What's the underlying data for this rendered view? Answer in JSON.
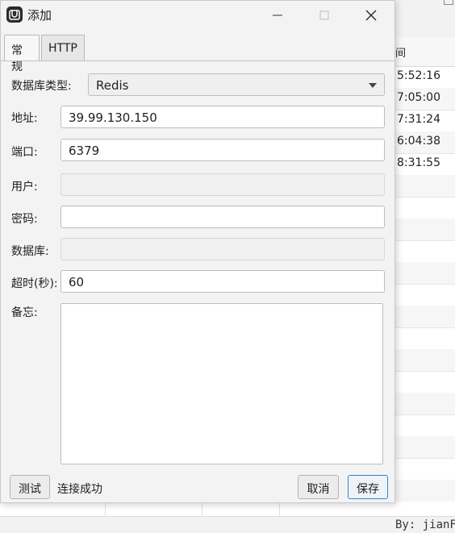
{
  "dialog": {
    "title": "添加",
    "tabs": [
      {
        "label": "常规",
        "active": true
      },
      {
        "label": "HTTP",
        "active": false
      }
    ],
    "form": {
      "db_type": {
        "label": "数据库类型:",
        "value": "Redis"
      },
      "address": {
        "label": "地址:",
        "value": "39.99.130.150"
      },
      "port": {
        "label": "端口:",
        "value": "6379"
      },
      "user": {
        "label": "用户:",
        "value": "",
        "disabled": true
      },
      "password": {
        "label": "密码:",
        "value": ""
      },
      "database": {
        "label": "数据库:",
        "value": "",
        "disabled": true
      },
      "timeout": {
        "label": "超时(秒):",
        "value": "60"
      },
      "notes": {
        "label": "备忘:",
        "value": ""
      }
    },
    "buttons": {
      "test": "测试",
      "cancel": "取消",
      "save": "保存"
    },
    "status": "连接成功"
  },
  "background": {
    "column_header": "间",
    "rows": [
      "5:52:16",
      "7:05:00",
      "7:31:24",
      "6:04:38",
      "8:31:55"
    ],
    "status_bar": "By: jianFe"
  },
  "colors": {
    "dialog_bg": "#f3f3f3",
    "accent": "#3c7fd0"
  }
}
